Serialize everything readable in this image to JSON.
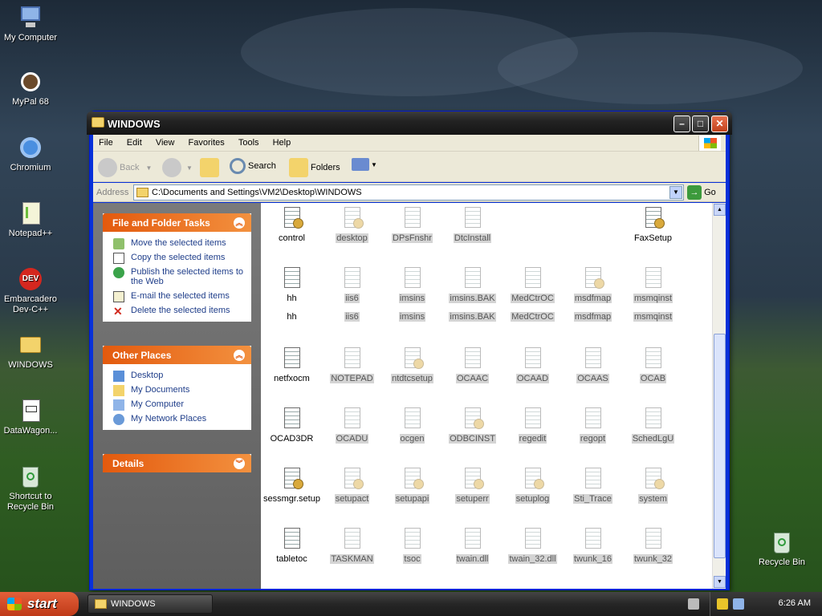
{
  "desktop": {
    "icons": [
      {
        "label": "My Computer"
      },
      {
        "label": "MyPal 68"
      },
      {
        "label": "Chromium"
      },
      {
        "label": "Notepad++"
      },
      {
        "label": "Embarcadero Dev-C++"
      },
      {
        "label": "WINDOWS"
      },
      {
        "label": "DataWagon..."
      },
      {
        "label": "Shortcut to Recycle Bin"
      },
      {
        "label": "Recycle Bin"
      }
    ]
  },
  "window": {
    "title": "WINDOWS",
    "menu": [
      "File",
      "Edit",
      "View",
      "Favorites",
      "Tools",
      "Help"
    ],
    "toolbar": {
      "back": "Back",
      "search": "Search",
      "folders": "Folders"
    },
    "address": {
      "label": "Address",
      "path": "C:\\Documents and Settings\\VM2\\Desktop\\WINDOWS",
      "go": "Go"
    },
    "taskpane": {
      "file_tasks": {
        "title": "File and Folder Tasks",
        "items": [
          "Move the selected items",
          "Copy the selected items",
          "Publish the selected items to the Web",
          "E-mail the selected items",
          "Delete the selected items"
        ]
      },
      "other_places": {
        "title": "Other Places",
        "items": [
          "Desktop",
          "My Documents",
          "My Computer",
          "My Network Places"
        ]
      },
      "details": {
        "title": "Details"
      }
    },
    "files": {
      "row0": [
        "control",
        "desktop",
        "DPsFnshr",
        "DtcInstall",
        "FaxSetup"
      ],
      "row1": [
        "hh",
        "iis6",
        "imsins",
        "imsins.BAK",
        "MedCtrOC",
        "msdfmap",
        "msmqinst"
      ],
      "row1b": [
        "hh",
        "iis6",
        "imsins",
        "imsins.BAK",
        "MedCtrOC",
        "msdfmap",
        "msmqinst"
      ],
      "row2": [
        "netfxocm",
        "NOTEPAD",
        "ntdtcsetup",
        "OCAAC",
        "OCAAD",
        "OCAAS",
        "OCAB"
      ],
      "row3": [
        "OCAD3DR",
        "OCADU",
        "ocgen",
        "ODBCINST",
        "regedit",
        "regopt",
        "SchedLgU"
      ],
      "row4": [
        "sessmgr.setup",
        "setupact",
        "setupapi",
        "setuperr",
        "setuplog",
        "Sti_Trace",
        "system"
      ],
      "row5": [
        "tabletoc",
        "TASKMAN",
        "tsoc",
        "twain.dll",
        "twain_32.dll",
        "twunk_16",
        "twunk_32"
      ]
    }
  },
  "taskbar": {
    "start": "start",
    "task": "WINDOWS",
    "clock": "6:26 AM"
  }
}
